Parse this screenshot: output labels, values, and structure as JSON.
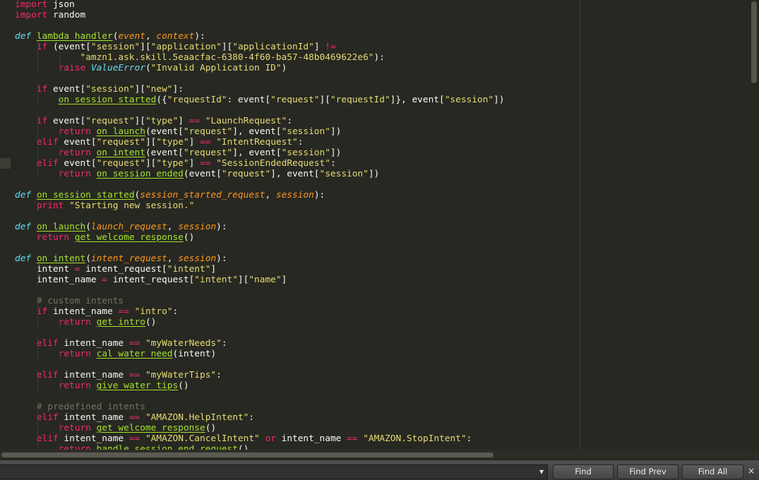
{
  "editor": {
    "lines": [
      [
        [
          "kw",
          "import"
        ],
        [
          "pl",
          " json"
        ]
      ],
      [
        [
          "kw",
          "import"
        ],
        [
          "pl",
          " random"
        ]
      ],
      [],
      [
        [
          "df",
          "def"
        ],
        [
          "pl",
          " "
        ],
        [
          "fn",
          "lambda_handler"
        ],
        [
          "pl",
          "("
        ],
        [
          "pa",
          "event"
        ],
        [
          "pl",
          ", "
        ],
        [
          "pa",
          "context"
        ],
        [
          "pl",
          "):"
        ]
      ],
      [
        [
          "pl",
          "    "
        ],
        [
          "kw",
          "if"
        ],
        [
          "pl",
          " (event["
        ],
        [
          "st",
          "\"session\""
        ],
        [
          "pl",
          "]["
        ],
        [
          "st",
          "\"application\""
        ],
        [
          "pl",
          "]["
        ],
        [
          "st",
          "\"applicationId\""
        ],
        [
          "pl",
          "] "
        ],
        [
          "kw",
          "!="
        ]
      ],
      [
        [
          "pl",
          "            "
        ],
        [
          "st",
          "\"amzn1.ask.skill.5eaacfac-6380-4f60-ba57-48b0469622e6\""
        ],
        [
          "pl",
          "):"
        ]
      ],
      [
        [
          "pl",
          "        "
        ],
        [
          "kw",
          "raise"
        ],
        [
          "pl",
          " "
        ],
        [
          "df",
          "ValueError"
        ],
        [
          "pl",
          "("
        ],
        [
          "st",
          "\"Invalid Application ID\""
        ],
        [
          "pl",
          ")"
        ]
      ],
      [],
      [
        [
          "pl",
          "    "
        ],
        [
          "kw",
          "if"
        ],
        [
          "pl",
          " event["
        ],
        [
          "st",
          "\"session\""
        ],
        [
          "pl",
          "]["
        ],
        [
          "st",
          "\"new\""
        ],
        [
          "pl",
          "]:"
        ]
      ],
      [
        [
          "pl",
          "        "
        ],
        [
          "fn",
          "on_session_started"
        ],
        [
          "pl",
          "({"
        ],
        [
          "st",
          "\"requestId\""
        ],
        [
          "pl",
          ": event["
        ],
        [
          "st",
          "\"request\""
        ],
        [
          "pl",
          "]["
        ],
        [
          "st",
          "\"requestId\""
        ],
        [
          "pl",
          "]}, event["
        ],
        [
          "st",
          "\"session\""
        ],
        [
          "pl",
          "])"
        ]
      ],
      [],
      [
        [
          "pl",
          "    "
        ],
        [
          "kw",
          "if"
        ],
        [
          "pl",
          " event["
        ],
        [
          "st",
          "\"request\""
        ],
        [
          "pl",
          "]["
        ],
        [
          "st",
          "\"type\""
        ],
        [
          "pl",
          "] "
        ],
        [
          "kw",
          "=="
        ],
        [
          "pl",
          " "
        ],
        [
          "st",
          "\"LaunchRequest\""
        ],
        [
          "pl",
          ":"
        ]
      ],
      [
        [
          "pl",
          "        "
        ],
        [
          "kw",
          "return"
        ],
        [
          "pl",
          " "
        ],
        [
          "fn",
          "on_launch"
        ],
        [
          "pl",
          "(event["
        ],
        [
          "st",
          "\"request\""
        ],
        [
          "pl",
          "], event["
        ],
        [
          "st",
          "\"session\""
        ],
        [
          "pl",
          "])"
        ]
      ],
      [
        [
          "pl",
          "    "
        ],
        [
          "kw",
          "elif"
        ],
        [
          "pl",
          " event["
        ],
        [
          "st",
          "\"request\""
        ],
        [
          "pl",
          "]["
        ],
        [
          "st",
          "\"type\""
        ],
        [
          "pl",
          "] "
        ],
        [
          "kw",
          "=="
        ],
        [
          "pl",
          " "
        ],
        [
          "st",
          "\"IntentRequest\""
        ],
        [
          "pl",
          ":"
        ]
      ],
      [
        [
          "pl",
          "        "
        ],
        [
          "kw",
          "return"
        ],
        [
          "pl",
          " "
        ],
        [
          "fn",
          "on_intent"
        ],
        [
          "pl",
          "(event["
        ],
        [
          "st",
          "\"request\""
        ],
        [
          "pl",
          "], event["
        ],
        [
          "st",
          "\"session\""
        ],
        [
          "pl",
          "])"
        ]
      ],
      [
        [
          "pl",
          "    "
        ],
        [
          "kw",
          "elif"
        ],
        [
          "pl",
          " event["
        ],
        [
          "st",
          "\"request\""
        ],
        [
          "pl",
          "]["
        ],
        [
          "st",
          "\"type\""
        ],
        [
          "pl",
          "] "
        ],
        [
          "kw",
          "=="
        ],
        [
          "pl",
          " "
        ],
        [
          "st",
          "\"SessionEndedRequest\""
        ],
        [
          "pl",
          ":"
        ]
      ],
      [
        [
          "pl",
          "        "
        ],
        [
          "kw",
          "return"
        ],
        [
          "pl",
          " "
        ],
        [
          "fn",
          "on_session_ended"
        ],
        [
          "pl",
          "(event["
        ],
        [
          "st",
          "\"request\""
        ],
        [
          "pl",
          "], event["
        ],
        [
          "st",
          "\"session\""
        ],
        [
          "pl",
          "])"
        ]
      ],
      [],
      [
        [
          "df",
          "def"
        ],
        [
          "pl",
          " "
        ],
        [
          "fn",
          "on_session_started"
        ],
        [
          "pl",
          "("
        ],
        [
          "pa",
          "session_started_request"
        ],
        [
          "pl",
          ", "
        ],
        [
          "pa",
          "session"
        ],
        [
          "pl",
          "):"
        ]
      ],
      [
        [
          "pl",
          "    "
        ],
        [
          "kw",
          "print"
        ],
        [
          "pl",
          " "
        ],
        [
          "st",
          "\"Starting new session.\""
        ]
      ],
      [],
      [
        [
          "df",
          "def"
        ],
        [
          "pl",
          " "
        ],
        [
          "fn",
          "on_launch"
        ],
        [
          "pl",
          "("
        ],
        [
          "pa",
          "launch_request"
        ],
        [
          "pl",
          ", "
        ],
        [
          "pa",
          "session"
        ],
        [
          "pl",
          "):"
        ]
      ],
      [
        [
          "pl",
          "    "
        ],
        [
          "kw",
          "return"
        ],
        [
          "pl",
          " "
        ],
        [
          "fn",
          "get_welcome_response"
        ],
        [
          "pl",
          "()"
        ]
      ],
      [],
      [
        [
          "df",
          "def"
        ],
        [
          "pl",
          " "
        ],
        [
          "fn",
          "on_intent"
        ],
        [
          "pl",
          "("
        ],
        [
          "pa",
          "intent_request"
        ],
        [
          "pl",
          ", "
        ],
        [
          "pa",
          "session"
        ],
        [
          "pl",
          "):"
        ]
      ],
      [
        [
          "pl",
          "    intent "
        ],
        [
          "kw",
          "="
        ],
        [
          "pl",
          " intent_request["
        ],
        [
          "st",
          "\"intent\""
        ],
        [
          "pl",
          "]"
        ]
      ],
      [
        [
          "pl",
          "    intent_name "
        ],
        [
          "kw",
          "="
        ],
        [
          "pl",
          " intent_request["
        ],
        [
          "st",
          "\"intent\""
        ],
        [
          "pl",
          "]["
        ],
        [
          "st",
          "\"name\""
        ],
        [
          "pl",
          "]"
        ]
      ],
      [],
      [
        [
          "pl",
          "    "
        ],
        [
          "cm",
          "# custom intents"
        ]
      ],
      [
        [
          "pl",
          "    "
        ],
        [
          "kw",
          "if"
        ],
        [
          "pl",
          " intent_name "
        ],
        [
          "kw",
          "=="
        ],
        [
          "pl",
          " "
        ],
        [
          "st",
          "\"intro\""
        ],
        [
          "pl",
          ":"
        ]
      ],
      [
        [
          "pl",
          "        "
        ],
        [
          "kw",
          "return"
        ],
        [
          "pl",
          " "
        ],
        [
          "fn",
          "get_intro"
        ],
        [
          "pl",
          "()"
        ]
      ],
      [],
      [
        [
          "pl",
          "    "
        ],
        [
          "kw",
          "elif"
        ],
        [
          "pl",
          " intent_name "
        ],
        [
          "kw",
          "=="
        ],
        [
          "pl",
          " "
        ],
        [
          "st",
          "\"myWaterNeeds\""
        ],
        [
          "pl",
          ":"
        ]
      ],
      [
        [
          "pl",
          "        "
        ],
        [
          "kw",
          "return"
        ],
        [
          "pl",
          " "
        ],
        [
          "fn",
          "cal_water_need"
        ],
        [
          "pl",
          "(intent)"
        ]
      ],
      [],
      [
        [
          "pl",
          "    "
        ],
        [
          "kw",
          "elif"
        ],
        [
          "pl",
          " intent_name "
        ],
        [
          "kw",
          "=="
        ],
        [
          "pl",
          " "
        ],
        [
          "st",
          "\"myWaterTips\""
        ],
        [
          "pl",
          ":"
        ]
      ],
      [
        [
          "pl",
          "        "
        ],
        [
          "kw",
          "return"
        ],
        [
          "pl",
          " "
        ],
        [
          "fn",
          "give_water_tips"
        ],
        [
          "pl",
          "()"
        ]
      ],
      [],
      [
        [
          "pl",
          "    "
        ],
        [
          "cm",
          "# predefined intents"
        ]
      ],
      [
        [
          "pl",
          "    "
        ],
        [
          "kw",
          "elif"
        ],
        [
          "pl",
          " intent_name "
        ],
        [
          "kw",
          "=="
        ],
        [
          "pl",
          " "
        ],
        [
          "st",
          "\"AMAZON.HelpIntent\""
        ],
        [
          "pl",
          ":"
        ]
      ],
      [
        [
          "pl",
          "        "
        ],
        [
          "kw",
          "return"
        ],
        [
          "pl",
          " "
        ],
        [
          "fn",
          "get_welcome_response"
        ],
        [
          "pl",
          "()"
        ]
      ],
      [
        [
          "pl",
          "    "
        ],
        [
          "kw",
          "elif"
        ],
        [
          "pl",
          " intent_name "
        ],
        [
          "kw",
          "=="
        ],
        [
          "pl",
          " "
        ],
        [
          "st",
          "\"AMAZON.CancelIntent\""
        ],
        [
          "pl",
          " "
        ],
        [
          "kw",
          "or"
        ],
        [
          "pl",
          " intent_name "
        ],
        [
          "kw",
          "=="
        ],
        [
          "pl",
          " "
        ],
        [
          "st",
          "\"AMAZON.StopIntent\""
        ],
        [
          "pl",
          ":"
        ]
      ],
      [
        [
          "pl",
          "        "
        ],
        [
          "kw",
          "return"
        ],
        [
          "pl",
          " "
        ],
        [
          "fn",
          "handle_session_end_request"
        ],
        [
          "pl",
          "()"
        ]
      ]
    ],
    "colors": {
      "background": "#272822",
      "foreground": "#f8f8f2",
      "keyword": "#f92672",
      "storage": "#66d9ef",
      "function": "#a6e22e",
      "parameter": "#fd971f",
      "string": "#e6db74",
      "comment": "#75715e"
    }
  },
  "findbar": {
    "search_value": "",
    "dropdown_icon": "▾",
    "find_label": "Find",
    "find_prev_label": "Find Prev",
    "find_all_label": "Find All",
    "close_icon": "×"
  }
}
